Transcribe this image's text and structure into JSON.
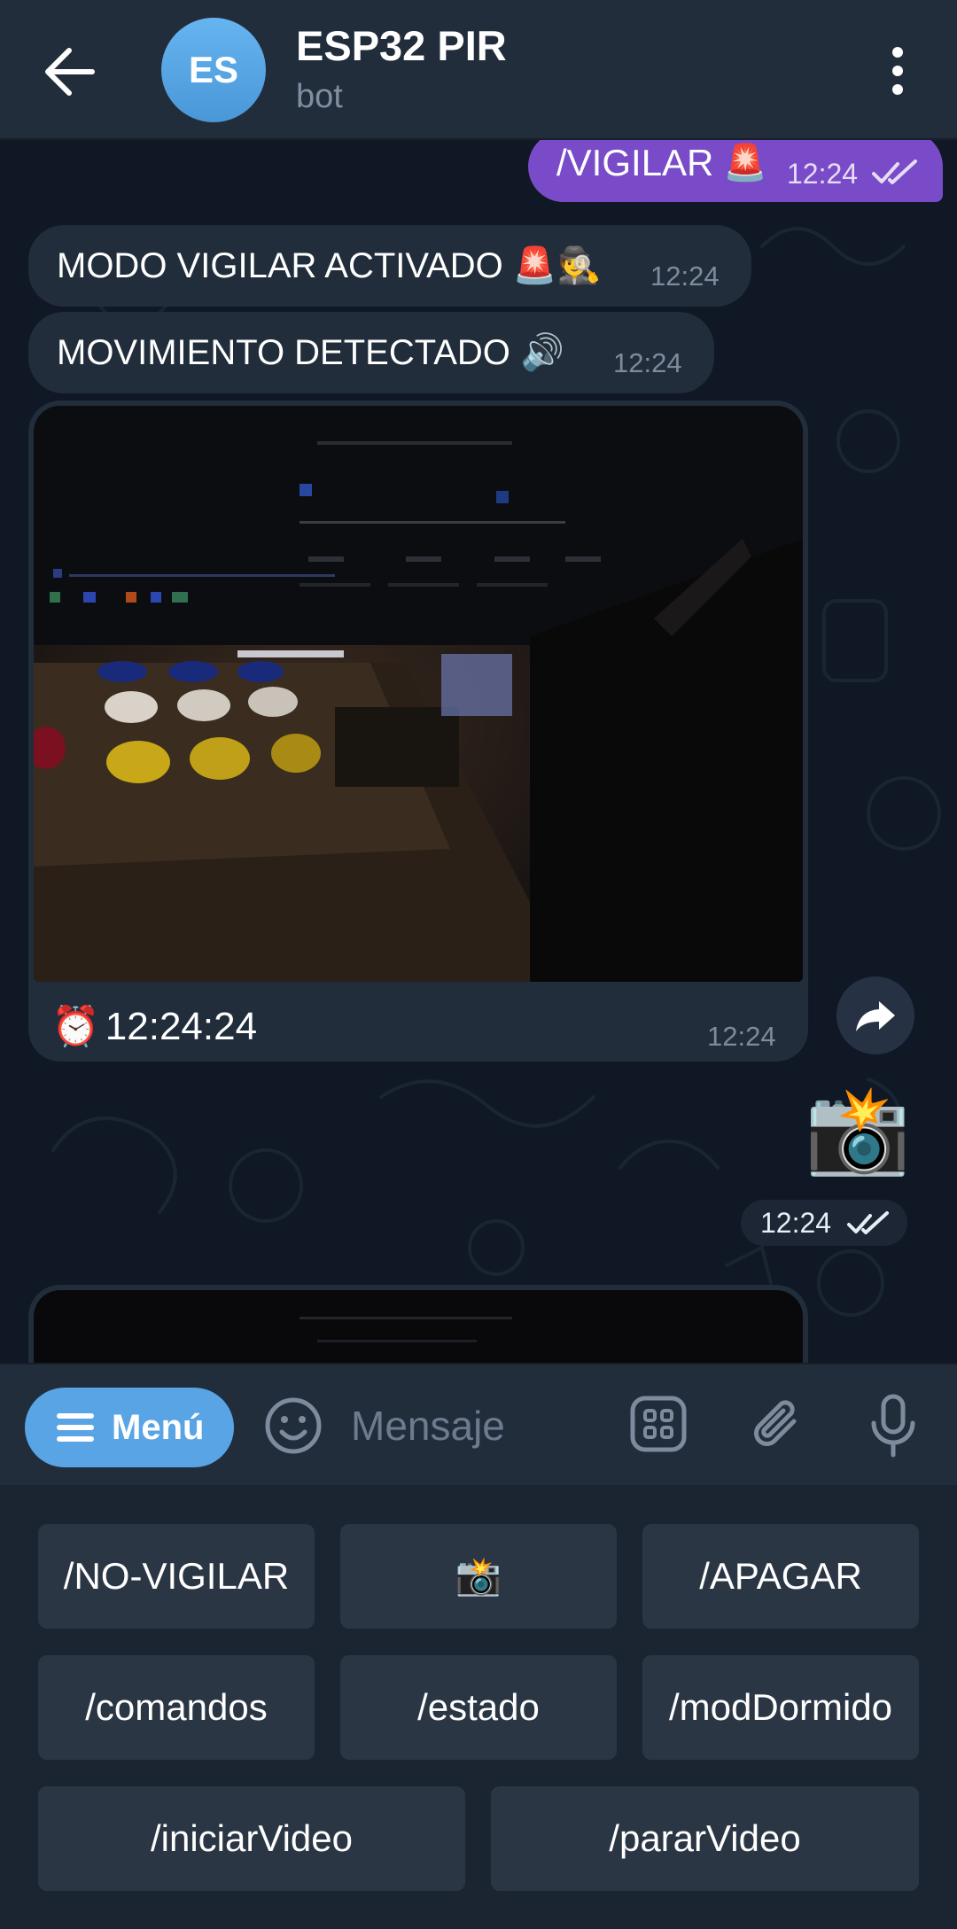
{
  "header": {
    "title": "ESP32 PIR",
    "subtitle": "bot",
    "avatar_initials": "ES",
    "avatar_color": "#5aa7e6"
  },
  "messages": {
    "outgoing_command": {
      "text": "/VIGILAR",
      "emoji": "🚨",
      "time": "12:24"
    },
    "incoming_1": {
      "text": "MODO VIGILAR ACTIVADO 🚨🕵️",
      "time": "12:24"
    },
    "incoming_2": {
      "text": "MOVIMIENTO DETECTADO 🔊",
      "time": "12:24"
    },
    "photo": {
      "caption_emoji": "⏰",
      "caption": "12:24:24",
      "time": "12:24"
    },
    "sticker": {
      "emoji": "📸",
      "time": "12:24"
    }
  },
  "input_bar": {
    "menu_label": "Menú",
    "placeholder": "Mensaje"
  },
  "keyboard": {
    "row1": [
      "/NO-VIGILAR",
      "📸",
      "/APAGAR"
    ],
    "row2": [
      "/comandos",
      "/estado",
      "/modDormido"
    ],
    "row3": [
      "/iniciarVideo",
      "/pararVideo"
    ]
  },
  "colors": {
    "outgoing_bubble": "#7a4bc8",
    "incoming_bubble": "#212d3b",
    "accent": "#59a4e5",
    "chat_background": "#0f1824"
  }
}
